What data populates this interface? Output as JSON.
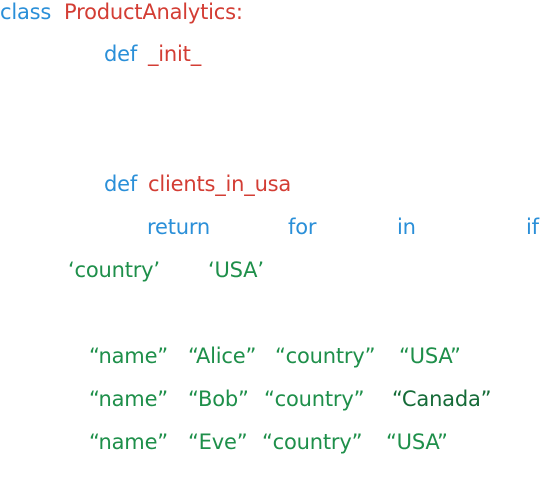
{
  "colors": {
    "keyword": "#2a8fd8",
    "identifier": "#d33d34",
    "string": "#1e8f4a",
    "string_dark": "#156b38",
    "background": "#ffffff"
  },
  "code": {
    "line1": {
      "kw_class": "class",
      "class_name": "ProductAnalytics:"
    },
    "line2": {
      "kw_def": "def",
      "func_name": "_init_"
    },
    "line3": {
      "kw_def": "def",
      "func_name": "clients_in_usa"
    },
    "line4": {
      "kw_return": "return",
      "kw_for": "for",
      "kw_in": "in",
      "kw_if": "if"
    },
    "line5": {
      "key": "‘country’",
      "value": "‘USA’"
    },
    "records": [
      {
        "k1": "“name”",
        "v1": "“Alice”",
        "k2": "“country”",
        "v2": "“USA”"
      },
      {
        "k1": "“name”",
        "v1": "“Bob”",
        "k2": "“country”",
        "v2": "“Canada”"
      },
      {
        "k1": "“name”",
        "v1": "“Eve”",
        "k2": "“country”",
        "v2": "“USA”"
      }
    ]
  }
}
